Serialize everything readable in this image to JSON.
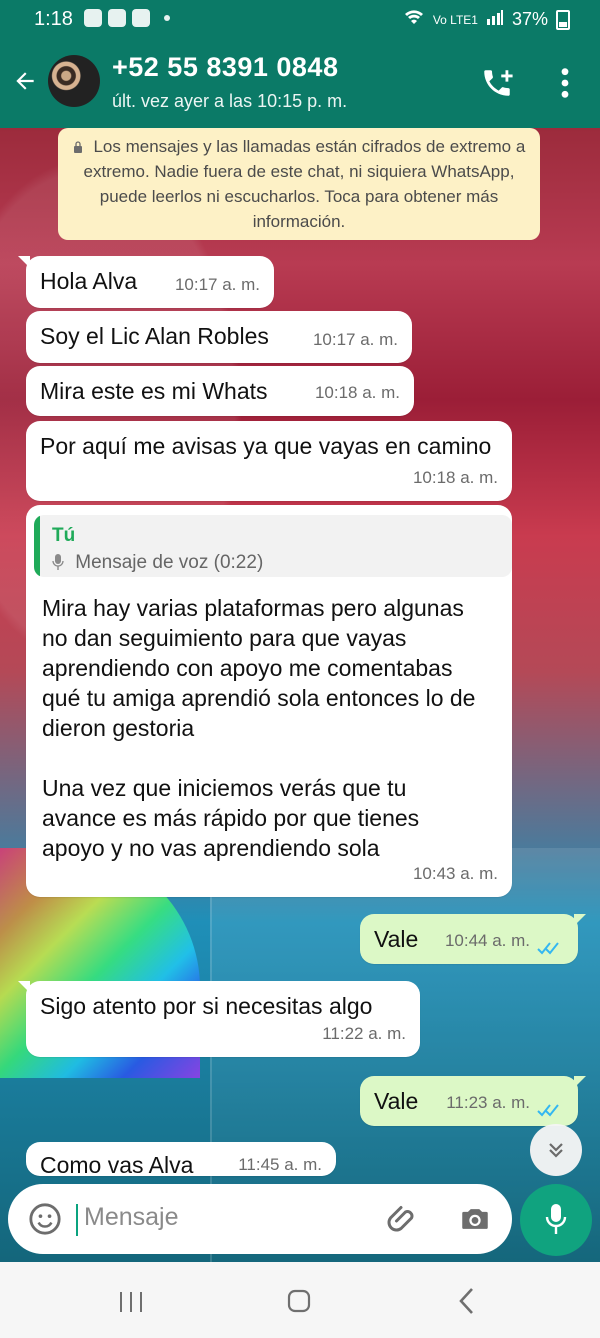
{
  "status_bar": {
    "time": "1:18",
    "battery": "37%",
    "signal": "Vo LTE1"
  },
  "header": {
    "title": "+52 55 8391 0848",
    "subtitle": "últ. vez ayer a las 10:15 p. m."
  },
  "system_message": {
    "text": "Los mensajes y las llamadas están cifrados de extremo a extremo. Nadie fuera de este chat, ni siquiera WhatsApp, puede leerlos ni escucharlos. Toca para obtener más información."
  },
  "messages": [
    {
      "text": "Hola Alva",
      "time": "10:17 a. m."
    },
    {
      "text": "Soy el Lic Alan Robles",
      "time": "10:17 a. m."
    },
    {
      "text": "Mira este es mi Whats",
      "time": "10:18 a. m."
    },
    {
      "text": "Por aquí me avisas ya que vayas en camino",
      "time": "10:18 a. m."
    },
    {
      "reply_author": "Tú",
      "reply_preview": "Mensaje de voz (0:22)",
      "paragraph_1": "Mira hay varias plataformas pero algunas no dan seguimiento para que vayas aprendiendo con apoyo me comentabas qué tu amiga aprendió sola entonces lo de dieron gestoria",
      "paragraph_2": "Una vez que iniciemos verás que tu avance es más rápido por que tienes apoyo y no vas aprendiendo sola",
      "time": "10:43 a. m."
    },
    {
      "text": "Vale",
      "time": "10:44 a. m."
    },
    {
      "text": "Sigo atento por si necesitas algo",
      "time": "11:22 a. m."
    },
    {
      "text": "Vale",
      "time": "11:23 a. m."
    },
    {
      "text": "Como vas Alva",
      "time": "11:45 a. m."
    }
  ],
  "input": {
    "placeholder": "Mensaje"
  },
  "icons": {
    "back": "back-arrow-icon",
    "call": "call-add-icon",
    "more": "more-vertical-icon",
    "emoji": "emoji-icon",
    "attach": "paperclip-icon",
    "camera": "camera-icon",
    "mic": "microphone-icon",
    "scroll": "double-chevron-down-icon"
  },
  "colors": {
    "header": "#0b7a67",
    "outgoing_bubble": "#dcf8c6",
    "incoming_bubble": "#ffffff",
    "system_note": "#fdf1c6",
    "accent": "#10a37f",
    "read_receipt": "#34b7f1"
  }
}
